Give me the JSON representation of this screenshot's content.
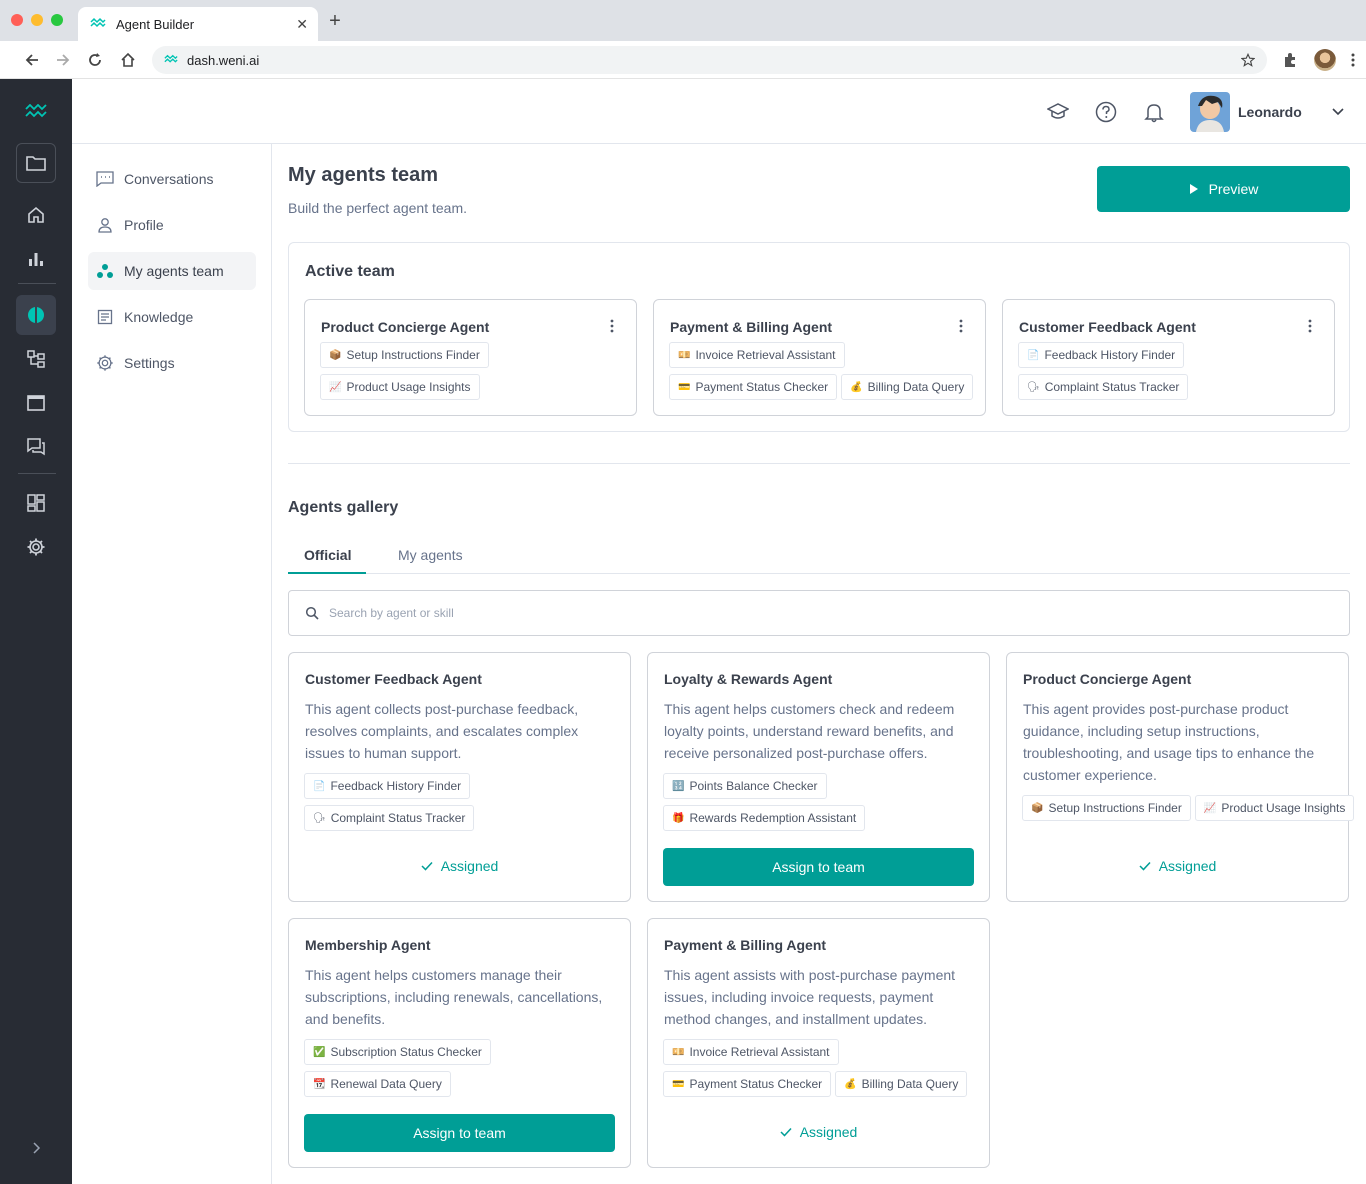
{
  "browser": {
    "tab_title": "Agent Builder",
    "tab_close": "✕",
    "new_tab": "+",
    "url": "dash.weni.ai"
  },
  "header": {
    "user_name": "Leonardo"
  },
  "subnav": {
    "items": [
      {
        "label": "Conversations"
      },
      {
        "label": "Profile"
      },
      {
        "label": "My agents team"
      },
      {
        "label": "Knowledge"
      },
      {
        "label": "Settings"
      }
    ]
  },
  "page": {
    "title": "My agents team",
    "subtitle": "Build the perfect agent team.",
    "preview_label": "Preview"
  },
  "active_team": {
    "title": "Active team",
    "agents": [
      {
        "name": "Product Concierge Agent",
        "skills": [
          {
            "icon": "📦",
            "label": "Setup Instructions Finder"
          },
          {
            "icon": "📈",
            "label": "Product Usage Insights"
          }
        ]
      },
      {
        "name": "Payment & Billing Agent",
        "skills": [
          {
            "icon": "💴",
            "label": "Invoice Retrieval Assistant"
          },
          {
            "icon": "💳",
            "label": "Payment Status Checker"
          },
          {
            "icon": "💰",
            "label": "Billing Data Query"
          }
        ]
      },
      {
        "name": "Customer Feedback Agent",
        "skills": [
          {
            "icon": "📄",
            "label": "Feedback History Finder"
          },
          {
            "icon": "🗣",
            "label": "Complaint Status Tracker"
          }
        ]
      }
    ]
  },
  "gallery": {
    "title": "Agents gallery",
    "tabs": [
      {
        "label": "Official"
      },
      {
        "label": "My agents"
      }
    ],
    "search_placeholder": "Search by agent or skill",
    "assign_label": "Assign to team",
    "assigned_label": "Assigned",
    "cards": [
      {
        "name": "Customer Feedback Agent",
        "description": "This agent collects post-purchase feedback, resolves complaints, and escalates complex issues to human support.",
        "skills": [
          {
            "icon": "📄",
            "label": "Feedback History Finder"
          },
          {
            "icon": "🗣",
            "label": "Complaint Status Tracker"
          }
        ],
        "status": "assigned"
      },
      {
        "name": "Loyalty & Rewards Agent",
        "description": "This agent helps customers check and redeem loyalty points, understand reward benefits, and receive personalized post-purchase offers.",
        "skills": [
          {
            "icon": "🔢",
            "label": "Points Balance Checker"
          },
          {
            "icon": "🎁",
            "label": "Rewards Redemption Assistant"
          }
        ],
        "status": "assign"
      },
      {
        "name": "Product Concierge Agent",
        "description": "This agent provides post-purchase product guidance, including setup instructions, troubleshooting, and usage tips to enhance the customer experience.",
        "skills": [
          {
            "icon": "📦",
            "label": "Setup Instructions Finder"
          },
          {
            "icon": "📈",
            "label": "Product Usage Insights"
          }
        ],
        "status": "assigned"
      },
      {
        "name": "Membership Agent",
        "description": "This agent helps customers manage their subscriptions, including renewals, cancellations, and benefits.",
        "skills": [
          {
            "icon": "✅",
            "label": "Subscription Status Checker"
          },
          {
            "icon": "📆",
            "label": "Renewal Data Query"
          }
        ],
        "status": "assign"
      },
      {
        "name": "Payment & Billing Agent",
        "description": "This agent assists with post-purchase payment issues, including invoice requests, payment method changes, and installment updates.",
        "skills": [
          {
            "icon": "💴",
            "label": "Invoice Retrieval Assistant"
          },
          {
            "icon": "💳",
            "label": "Payment Status Checker"
          },
          {
            "icon": "💰",
            "label": "Billing Data Query"
          }
        ],
        "status": "assigned"
      }
    ]
  },
  "colors": {
    "accent": "#009e96",
    "sidebar": "#282c34"
  },
  "icons": [
    "weni-logo-icon",
    "folder-icon",
    "home-icon",
    "chart-icon",
    "agent-builder-icon",
    "flows-icon",
    "window-icon",
    "chat-icon",
    "apps-icon",
    "gear-icon",
    "expand-chevron-icon",
    "graduation-cap-icon",
    "help-icon",
    "bell-icon",
    "chevron-down-icon",
    "search-icon",
    "play-icon",
    "check-icon",
    "kebab-menu-icon"
  ]
}
